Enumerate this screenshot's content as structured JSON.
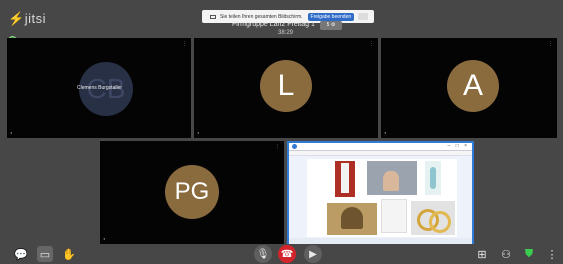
{
  "app": {
    "logo_text": "jitsi"
  },
  "share_banner": {
    "message": "Sie teilen Ihren gesamten Bildschirm.",
    "stop_label": "Freigabe beenden",
    "hide_label": "—"
  },
  "meeting": {
    "title": "Firmgruppe Lan2 Freitag 1",
    "timer": "38:29",
    "badge": "5 ⚙"
  },
  "participants": [
    {
      "initials": "CB",
      "label": "Clemens Burgstaller",
      "name_tag": "◖"
    },
    {
      "initials": "L",
      "name_tag": "◖"
    },
    {
      "initials": "A",
      "name_tag": "◖"
    },
    {
      "initials": "PG",
      "name_tag": "◖"
    }
  ],
  "screen_share": {
    "window_buttons": "– □ ×"
  },
  "toolbar": {
    "chat": "💬",
    "screenshare": "▭",
    "raise_hand": "✋",
    "mic": "🎙",
    "hangup": "☎",
    "camera": "▶",
    "tile_view": "⊞",
    "participants": "⚇",
    "security": "⛊",
    "more": "⋮"
  },
  "colors": {
    "accent": "#2f7bd6",
    "avatar": "#8a6b3d",
    "hangup": "#d3242c"
  }
}
